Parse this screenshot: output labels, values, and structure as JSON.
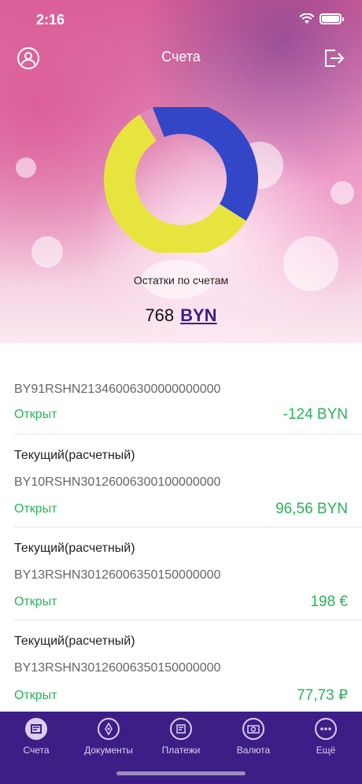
{
  "status_bar": {
    "time": "2:16"
  },
  "header": {
    "title": "Счета"
  },
  "summary": {
    "label": "Остатки по счетам",
    "total_amount": "768",
    "currency": "BYN",
    "donut": [
      {
        "share": 0.4,
        "color": "#3346c8"
      },
      {
        "share": 0.57,
        "color": "#e8e43e"
      },
      {
        "share": 0.03,
        "color": "#e088b6"
      }
    ]
  },
  "accounts": [
    {
      "type": "",
      "iban": "BY91RSHN21346006300000000000",
      "status": "Открыт",
      "balance": "-124 BYN"
    },
    {
      "type": "Текущий(расчетный)",
      "iban": "BY10RSHN30126006300100000000",
      "status": "Открыт",
      "balance": "96,56 BYN"
    },
    {
      "type": "Текущий(расчетный)",
      "iban": "BY13RSHN30126006350150000000",
      "status": "Открыт",
      "balance": "198 €"
    },
    {
      "type": "Текущий(расчетный)",
      "iban": "BY13RSHN30126006350150000000",
      "status": "Открыт",
      "balance": "77,73 ₽"
    }
  ],
  "tabbar": {
    "items": [
      {
        "label": "Счета",
        "icon": "accounts-icon",
        "active": true
      },
      {
        "label": "Документы",
        "icon": "documents-icon",
        "active": false
      },
      {
        "label": "Платежи",
        "icon": "payments-icon",
        "active": false
      },
      {
        "label": "Валюта",
        "icon": "currency-icon",
        "active": false
      },
      {
        "label": "Ещё",
        "icon": "more-icon",
        "active": false
      }
    ]
  }
}
